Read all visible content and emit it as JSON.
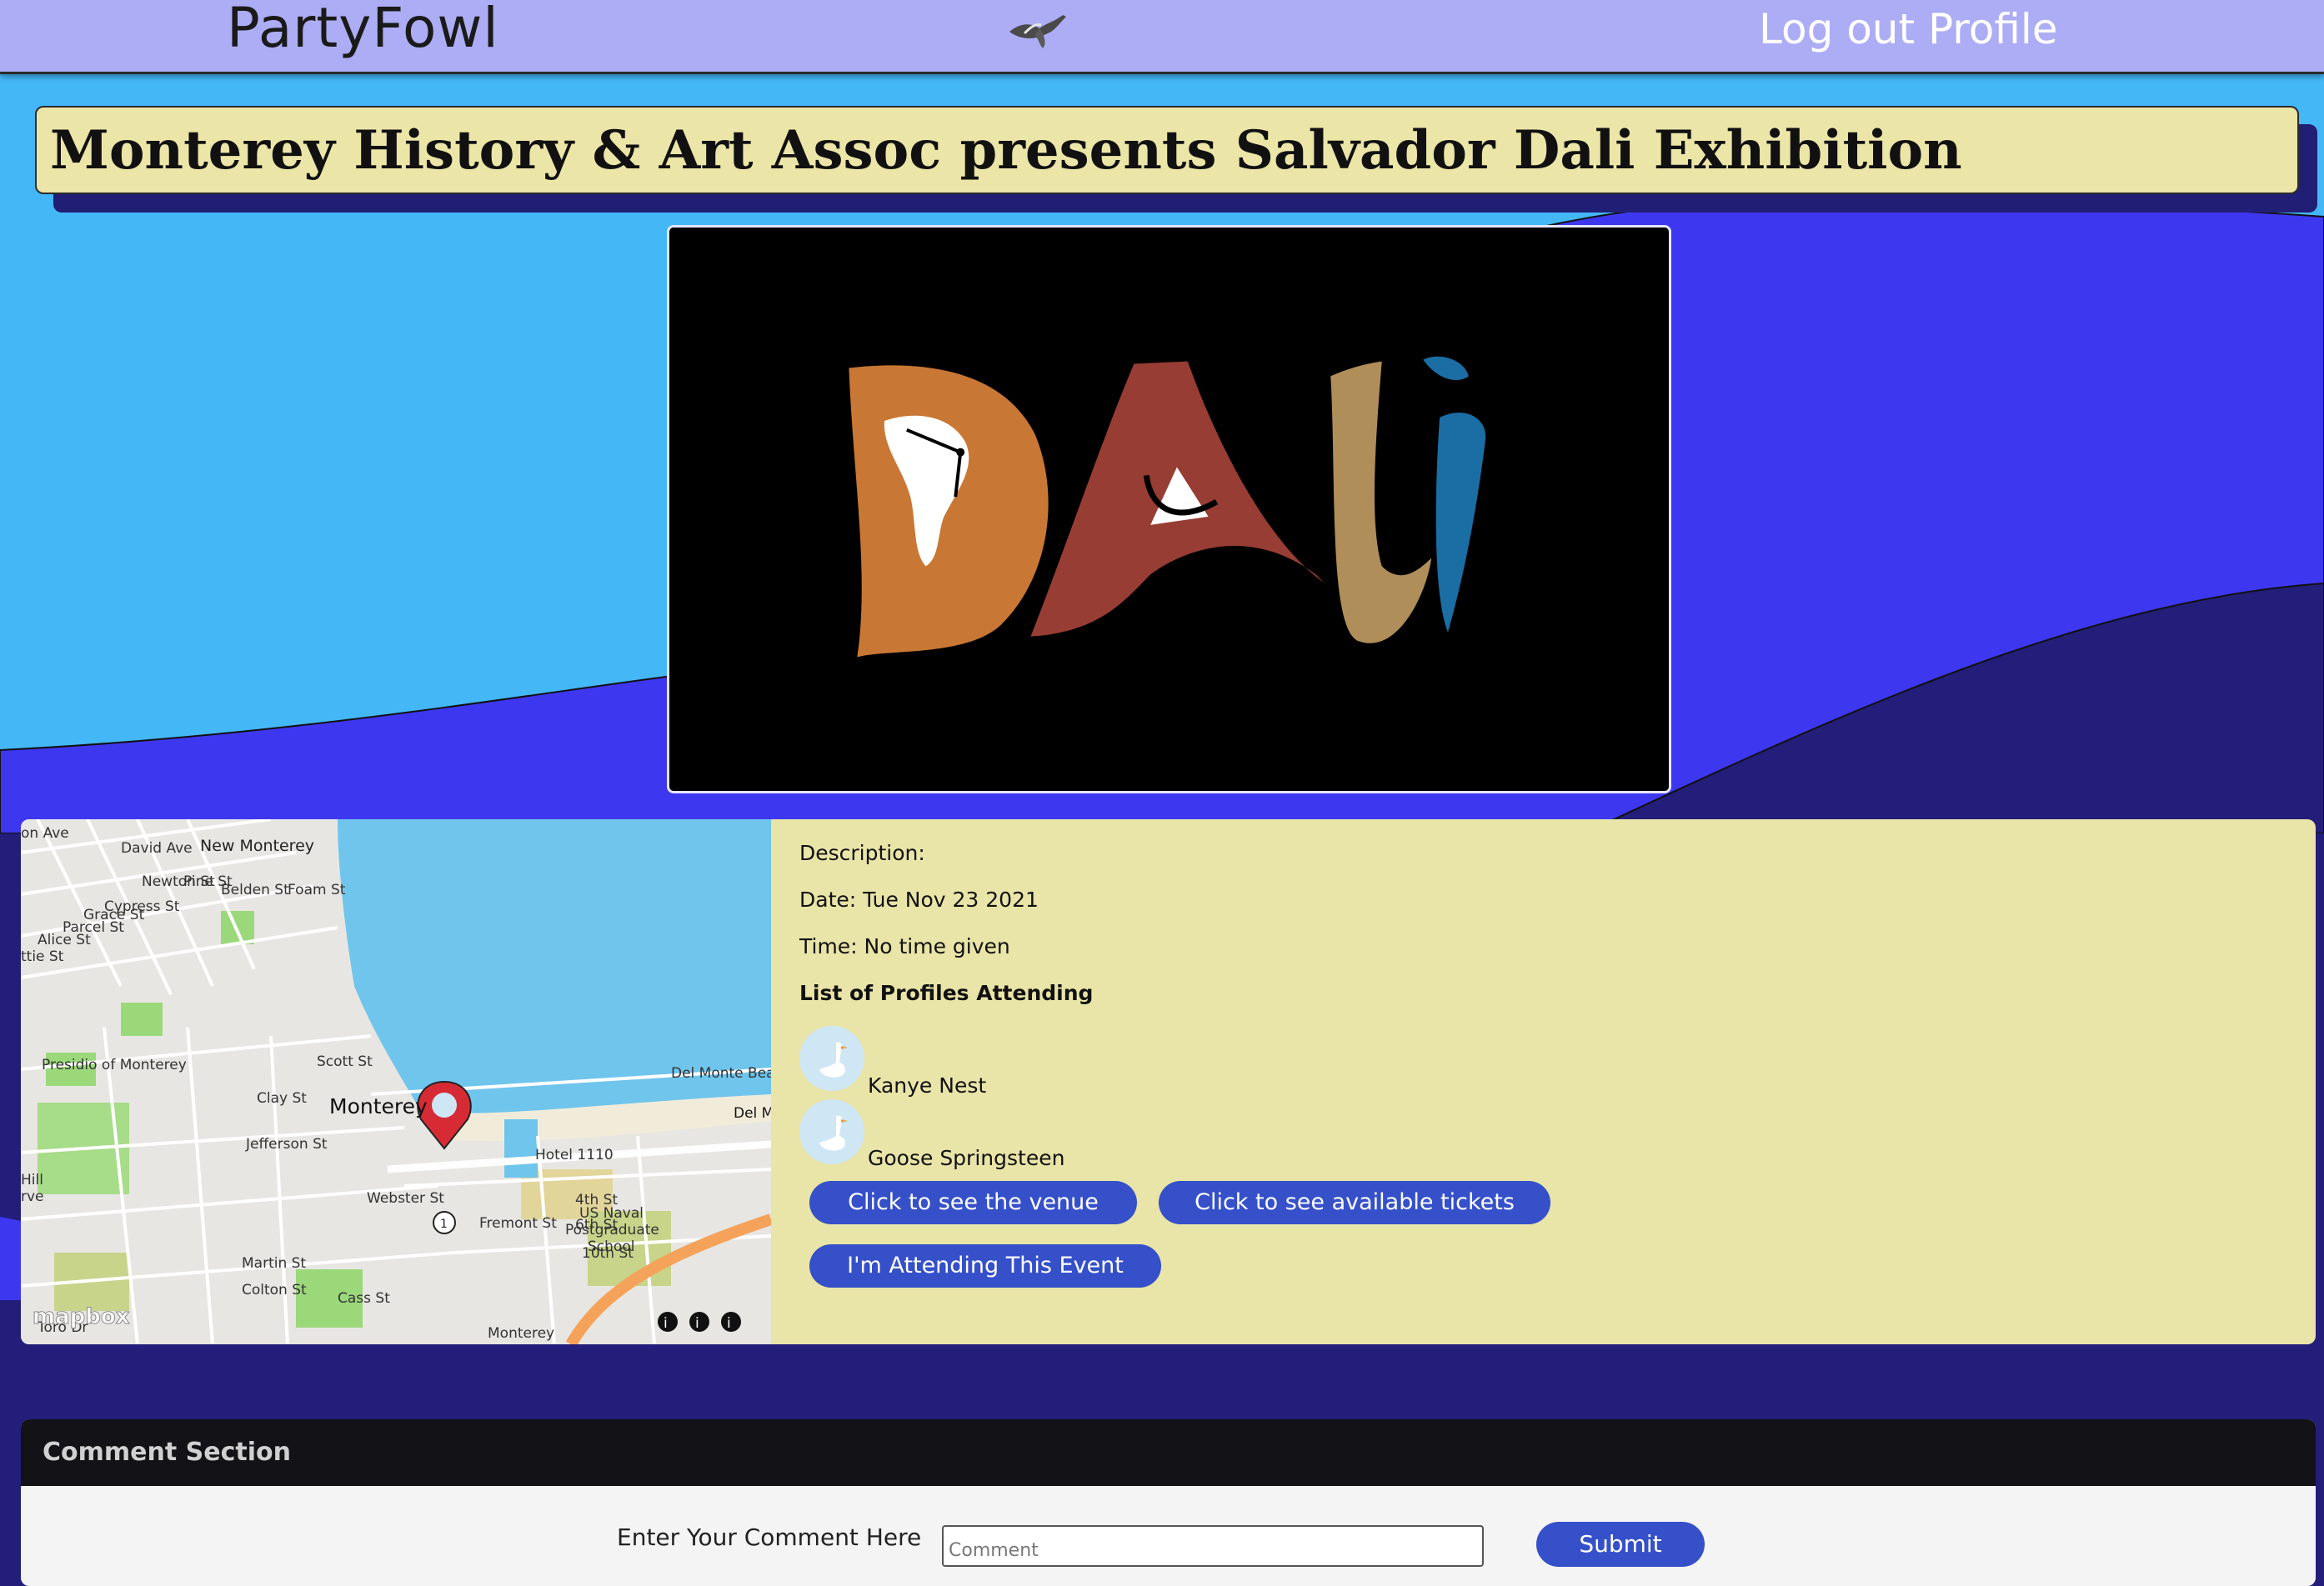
{
  "nav": {
    "brand": "PartyFowl",
    "logout_label": "Log out",
    "profile_label": "Profile"
  },
  "event": {
    "title": "Monterey History & Art Assoc presents Salvador Dali Exhibition",
    "hero_text": "DALI",
    "description_label": "Description:",
    "date_text": "Date: Tue Nov 23 2021",
    "time_text": "Time: No time given",
    "attendees_heading": "List of Profiles Attending",
    "attendees": [
      {
        "name": "Kanye Nest"
      },
      {
        "name": "Goose Springsteen"
      }
    ],
    "buttons": {
      "venue": "Click to see the venue",
      "tickets": "Click to see available tickets",
      "attending": "I'm Attending This Event"
    }
  },
  "map": {
    "city": "Monterey",
    "attribution": "mapbox",
    "labels": [
      "New Monterey",
      "Presidio of Monterey",
      "Del Monte Bea",
      "Del M",
      "Hotel 1110",
      "US Naval",
      "Postgraduate",
      "School",
      "Monterey",
      "David Ave",
      "Newton St",
      "Pine St",
      "Belden St",
      "Foam St",
      "Cypress St",
      "Grace St",
      "Parcel St",
      "Alice St",
      "Scott St",
      "Clay St",
      "Jefferson St",
      "Webster St",
      "Fremont St",
      "4th St",
      "6th St",
      "10th St",
      "Martin St",
      "Colton St",
      "Cass St",
      "Hill",
      "rve",
      "on Ave",
      "ttie St",
      "Toro Dr",
      "1"
    ]
  },
  "comments": {
    "heading": "Comment Section",
    "label": "Enter Your Comment Here",
    "placeholder": "Comment",
    "submit_label": "Submit"
  },
  "colors": {
    "nav": "#adadf5",
    "title_bg": "#ebe5a8",
    "panel_bg": "#e9e4a7",
    "button": "#3550c9",
    "bg_light_blue": "#44b7f7",
    "bg_blue": "#3e37f0",
    "bg_navy": "#221e7a"
  }
}
